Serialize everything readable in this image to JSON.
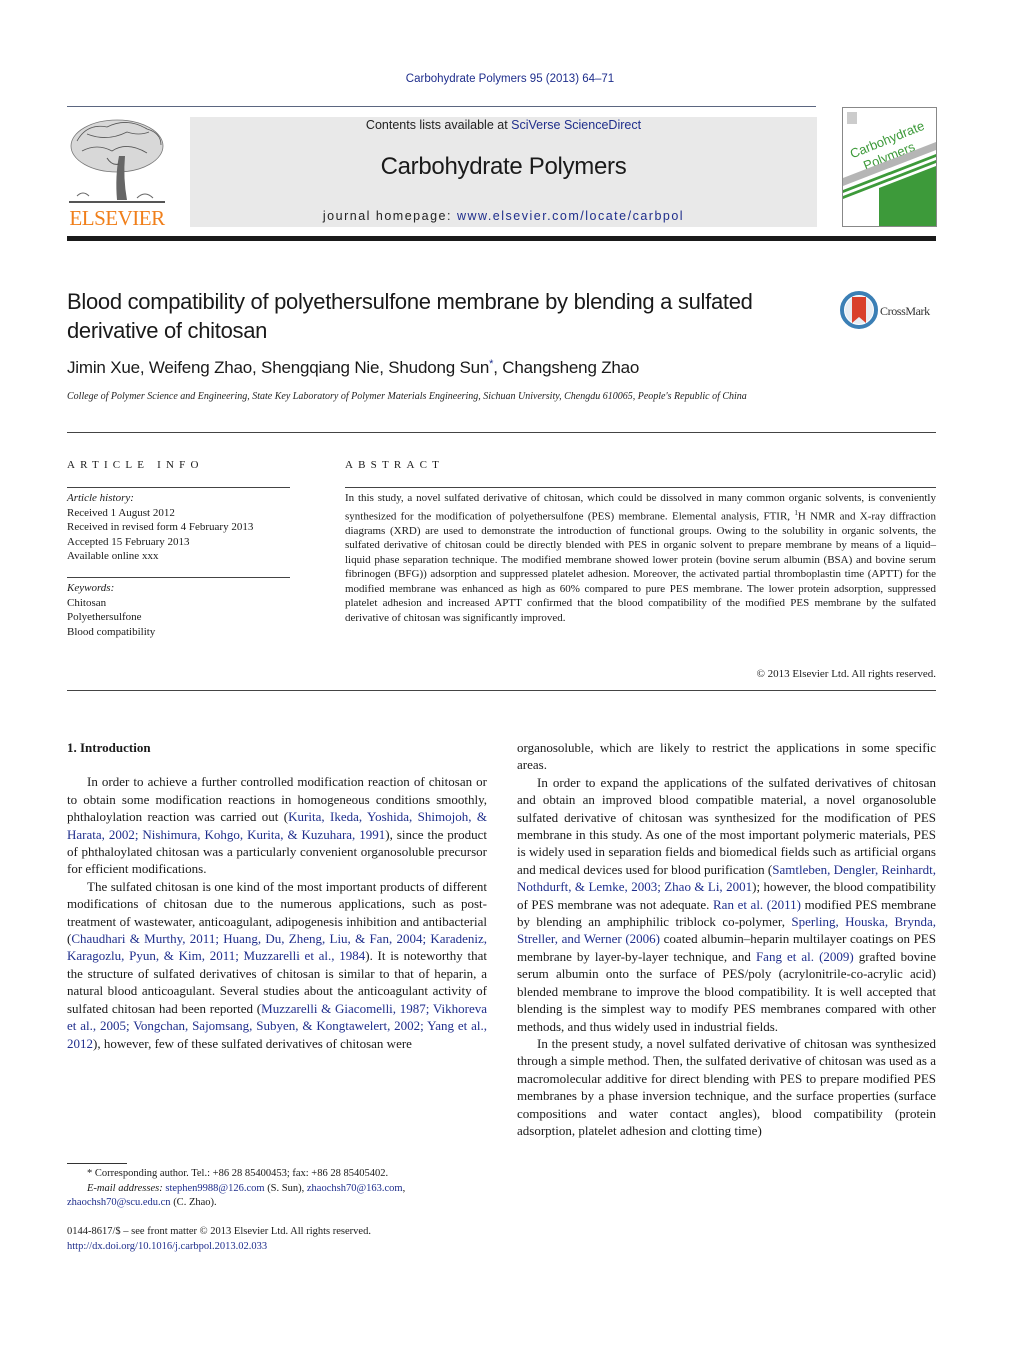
{
  "header": {
    "citation": "Carbohydrate Polymers 95 (2013) 64–71",
    "contents_prefix": "Contents lists available at ",
    "contents_link": "SciVerse ScienceDirect",
    "journal_name": "Carbohydrate Polymers",
    "homepage_prefix": "journal homepage: ",
    "homepage_link": "www.elsevier.com/locate/carbpol",
    "publisher_logo_text": "ELSEVIER",
    "cover_title_line1": "Carbohydrate",
    "cover_title_line2": "Polymers",
    "colors": {
      "link": "#1f2e8c",
      "elsevier_orange": "#f07f1a",
      "cover_green": "#3d9a3a",
      "masthead_bg": "#e9e9e9"
    }
  },
  "article": {
    "title": "Blood compatibility of polyethersulfone membrane by blending a sulfated derivative of chitosan",
    "crossmark_label": "CrossMark",
    "authors_before_star": "Jimin Xue, Weifeng Zhao, Shengqiang Nie, Shudong Sun",
    "author_star": "*",
    "authors_after_star": ", Changsheng Zhao",
    "affiliation": "College of Polymer Science and Engineering, State Key Laboratory of Polymer Materials Engineering, Sichuan University, Chengdu 610065, People's Republic of China"
  },
  "article_info": {
    "heading": "ARTICLE INFO",
    "history_label": "Article history:",
    "history": [
      "Received 1 August 2012",
      "Received in revised form 4 February 2013",
      "Accepted 15 February 2013",
      "Available online xxx"
    ],
    "keywords_label": "Keywords:",
    "keywords": [
      "Chitosan",
      "Polyethersulfone",
      "Blood compatibility"
    ]
  },
  "abstract": {
    "heading": "ABSTRACT",
    "text_part1": "In this study, a novel sulfated derivative of chitosan, which could be dissolved in many common organic solvents, is conveniently synthesized for the modification of polyethersulfone (PES) membrane. Elemental analysis, FTIR, ",
    "superscript": "1",
    "text_part2": "H NMR and X-ray diffraction diagrams (XRD) are used to demonstrate the introduction of functional groups. Owing to the solubility in organic solvents, the sulfated derivative of chitosan could be directly blended with PES in organic solvent to prepare membrane by means of a liquid–liquid phase separation technique. The modified membrane showed lower protein (bovine serum albumin (BSA) and bovine serum fibrinogen (BFG)) adsorption and suppressed platelet adhesion. Moreover, the activated partial thromboplastin time (APTT) for the modified membrane was enhanced as high as 60% compared to pure PES membrane. The lower protein adsorption, suppressed platelet adhesion and increased APTT confirmed that the blood compatibility of the modified PES membrane by the sulfated derivative of chitosan was significantly improved.",
    "copyright": "© 2013 Elsevier Ltd. All rights reserved."
  },
  "body": {
    "section_heading": "1.  Introduction",
    "left": {
      "p1_a": "In order to achieve a further controlled modification reaction of chitosan or to obtain some modification reactions in homogeneous conditions smoothly, phthaloylation reaction was carried out (",
      "p1_ref": "Kurita, Ikeda, Yoshida, Shimojoh, & Harata, 2002; Nishimura, Kohgo, Kurita, & Kuzuhara, 1991",
      "p1_b": "), since the product of phthaloylated chitosan was a particularly convenient organosoluble precursor for efficient modifications.",
      "p2_a": "The sulfated chitosan is one kind of the most important products of different modifications of chitosan due to the numerous applications, such as post-treatment of wastewater, anticoagulant, adipogenesis inhibition and antibacterial (",
      "p2_ref1": "Chaudhari & Murthy, 2011; Huang, Du, Zheng, Liu, & Fan, 2004; Karadeniz, Karagozlu, Pyun, & Kim, 2011; Muzzarelli et al., 1984",
      "p2_b": "). It is noteworthy that the structure of sulfated derivatives of chitosan is similar to that of heparin, a natural blood anticoagulant. Several studies about the anticoagulant activity of sulfated chitosan had been reported (",
      "p2_ref2": "Muzzarelli & Giacomelli, 1987; Vikhoreva et al., 2005; Vongchan, Sajomsang, Subyen, & Kongtawelert, 2002; Yang et al., 2012",
      "p2_c": "), however, few of these sulfated derivatives of chitosan were"
    },
    "right": {
      "p0": "organosoluble, which are likely to restrict the applications in some specific areas.",
      "p1_a": "In order to expand the applications of the sulfated derivatives of chitosan and obtain an improved blood compatible material, a novel organosoluble sulfated derivative of chitosan was synthesized for the modification of PES membrane in this study. As one of the most important polymeric materials, PES is widely used in separation fields and biomedical fields such as artificial organs and medical devices used for blood purification (",
      "p1_ref1": "Samtleben, Dengler, Reinhardt, Nothdurft, & Lemke, 2003; Zhao & Li, 2001",
      "p1_b": "); however, the blood compatibility of PES membrane was not adequate. ",
      "p1_ref2": "Ran et al. (2011)",
      "p1_c": " modified PES membrane by blending an amphiphilic triblock co-polymer, ",
      "p1_ref3": "Sperling, Houska, Brynda, Streller, and Werner (2006)",
      "p1_d": " coated albumin–heparin multilayer coatings on PES membrane by layer-by-layer technique, and ",
      "p1_ref4": "Fang et al. (2009)",
      "p1_e": " grafted bovine serum albumin onto the surface of PES/poly (acrylonitrile-co-acrylic acid) blended membrane to improve the blood compatibility. It is well accepted that blending is the simplest way to modify PES membranes compared with other methods, and thus widely used in industrial fields.",
      "p2": "In the present study, a novel sulfated derivative of chitosan was synthesized through a simple method. Then, the sulfated derivative of chitosan was used as a macromolecular additive for direct blending with PES to prepare modified PES membranes by a phase inversion technique, and the surface properties (surface compositions and water contact angles), blood compatibility (protein adsorption, platelet adhesion and clotting time)"
    }
  },
  "footnotes": {
    "star": "*",
    "corresponding": " Corresponding author. Tel.: +86 28 85400453; fax: +86 28 85405402.",
    "email_label": "E-mail addresses:",
    "email1": "stephen9988@126.com",
    "email1_owner": " (S. Sun), ",
    "email2": "zhaochsh70@163.com",
    "email2_sep": ",",
    "email3": "zhaochsh70@scu.edu.cn",
    "email3_owner": " (C. Zhao).",
    "front_matter": "0144-8617/$ – see front matter © 2013 Elsevier Ltd. All rights reserved.",
    "doi": "http://dx.doi.org/10.1016/j.carbpol.2013.02.033"
  }
}
